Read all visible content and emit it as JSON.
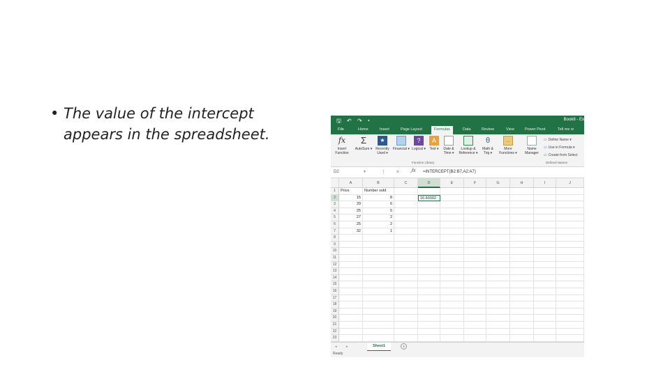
{
  "slide": {
    "bullet_symbol": "•",
    "bullet_lines": [
      "The value of the intercept",
      "appears in the spreadsheet."
    ]
  },
  "excel": {
    "quick_access": "🖫 ↶ ↷ ▾",
    "workbook_title": "Book8 - Ex",
    "tabs": [
      "File",
      "Home",
      "Insert",
      "Page Layout",
      "Formulas",
      "Data",
      "Review",
      "View",
      "Power Pivot",
      "Tell me w"
    ],
    "ribbon": {
      "insert_function": [
        "Insert",
        "Function"
      ],
      "autosum": "AutoSum ▾",
      "recently_used": [
        "Recently",
        "Used ▾"
      ],
      "financial": "Financial ▾",
      "logical": "Logical ▾",
      "text": "Text ▾",
      "date_time": [
        "Date &",
        "Time ▾"
      ],
      "lookup": [
        "Lookup &",
        "Reference ▾"
      ],
      "math": [
        "Math &",
        "Trig ▾"
      ],
      "more": [
        "More",
        "Functions ▾"
      ],
      "name_manager": [
        "Name",
        "Manager"
      ],
      "function_library_label": "Function Library",
      "defined_names_label": "Defined Names",
      "define_name": "Define Name ▾",
      "use_in_formula": "Use in Formula ▾",
      "create_from_selection": "Create from Select"
    },
    "name_box": "D2",
    "formula": "=INTERCEPT(B2:B7,A2:A7)",
    "columns": [
      "A",
      "B",
      "C",
      "D",
      "E",
      "F",
      "G",
      "H",
      "I",
      "J"
    ],
    "row_numbers": [
      "1",
      "2",
      "3",
      "4",
      "5",
      "6",
      "7",
      "8",
      "9",
      "10",
      "11",
      "12",
      "13",
      "14",
      "15",
      "16",
      "17",
      "18",
      "19",
      "20",
      "21",
      "22",
      "23"
    ],
    "cells": {
      "A1": "Price",
      "B1": "Number sold",
      "A2": "15",
      "B2": "8",
      "A3": "20",
      "B3": "6",
      "A4": "25",
      "B4": "5",
      "A5": "27",
      "B5": "2",
      "A6": "25",
      "B6": "2",
      "A7": "32",
      "B7": "1",
      "D2": "16.60302"
    },
    "active_cell": "D2",
    "sheet_tab": "Sheet1",
    "status": "Ready"
  }
}
